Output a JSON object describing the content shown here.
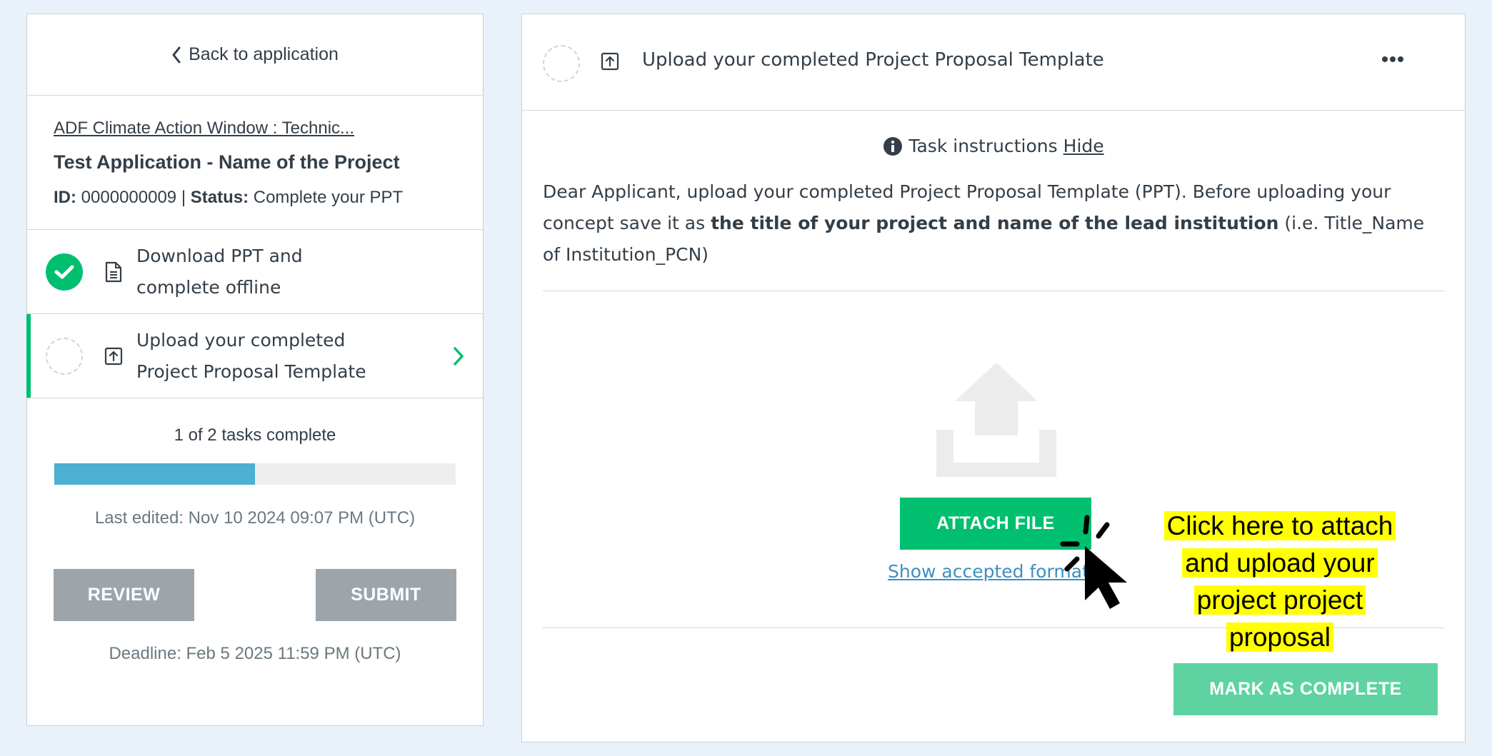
{
  "sidebar": {
    "back_label": "Back to application",
    "program_link": "ADF Climate Action Window : Technic...",
    "application_title": "Test Application - Name of the Project",
    "id_label": "ID:",
    "id_value": "0000000009",
    "separator": "|",
    "status_label": "Status:",
    "status_value": "Complete your PPT",
    "tasks": [
      {
        "line1": "Download PPT and",
        "line2": "complete offline",
        "state": "complete",
        "icon": "document-icon"
      },
      {
        "line1": "Upload your completed",
        "line2": "Project Proposal Template",
        "state": "incomplete",
        "icon": "upload-icon",
        "active": true
      }
    ],
    "progress_text": "1 of 2 tasks complete",
    "progress_fraction": 0.5,
    "last_edited": "Last edited: Nov 10 2024 09:07 PM (UTC)",
    "review_label": "REVIEW",
    "submit_label": "SUBMIT",
    "deadline": "Deadline: Feb 5 2025 11:59 PM (UTC)"
  },
  "task_panel": {
    "title": "Upload your completed Project Proposal Template",
    "instructions_label": "Task instructions",
    "hide_label": "Hide",
    "instructions_part1": "Dear Applicant, upload your completed Project Proposal Template (PPT). Before uploading your concept save it as ",
    "instructions_bold": "the title of your project and name of the lead institution",
    "instructions_part2": " (i.e. Title_Name of Institution_PCN)",
    "attach_label": "ATTACH FILE",
    "formats_link": "Show accepted formats",
    "mark_complete_label": "MARK AS COMPLETE"
  },
  "annotation": {
    "text_lines": [
      "Click here to attach",
      "and upload your",
      "project project",
      "proposal"
    ]
  },
  "colors": {
    "accent_green": "#00bf6f",
    "progress_blue": "#4bb0d1",
    "disabled_gray": "#9da5ab",
    "highlight_yellow": "#ffff00"
  }
}
